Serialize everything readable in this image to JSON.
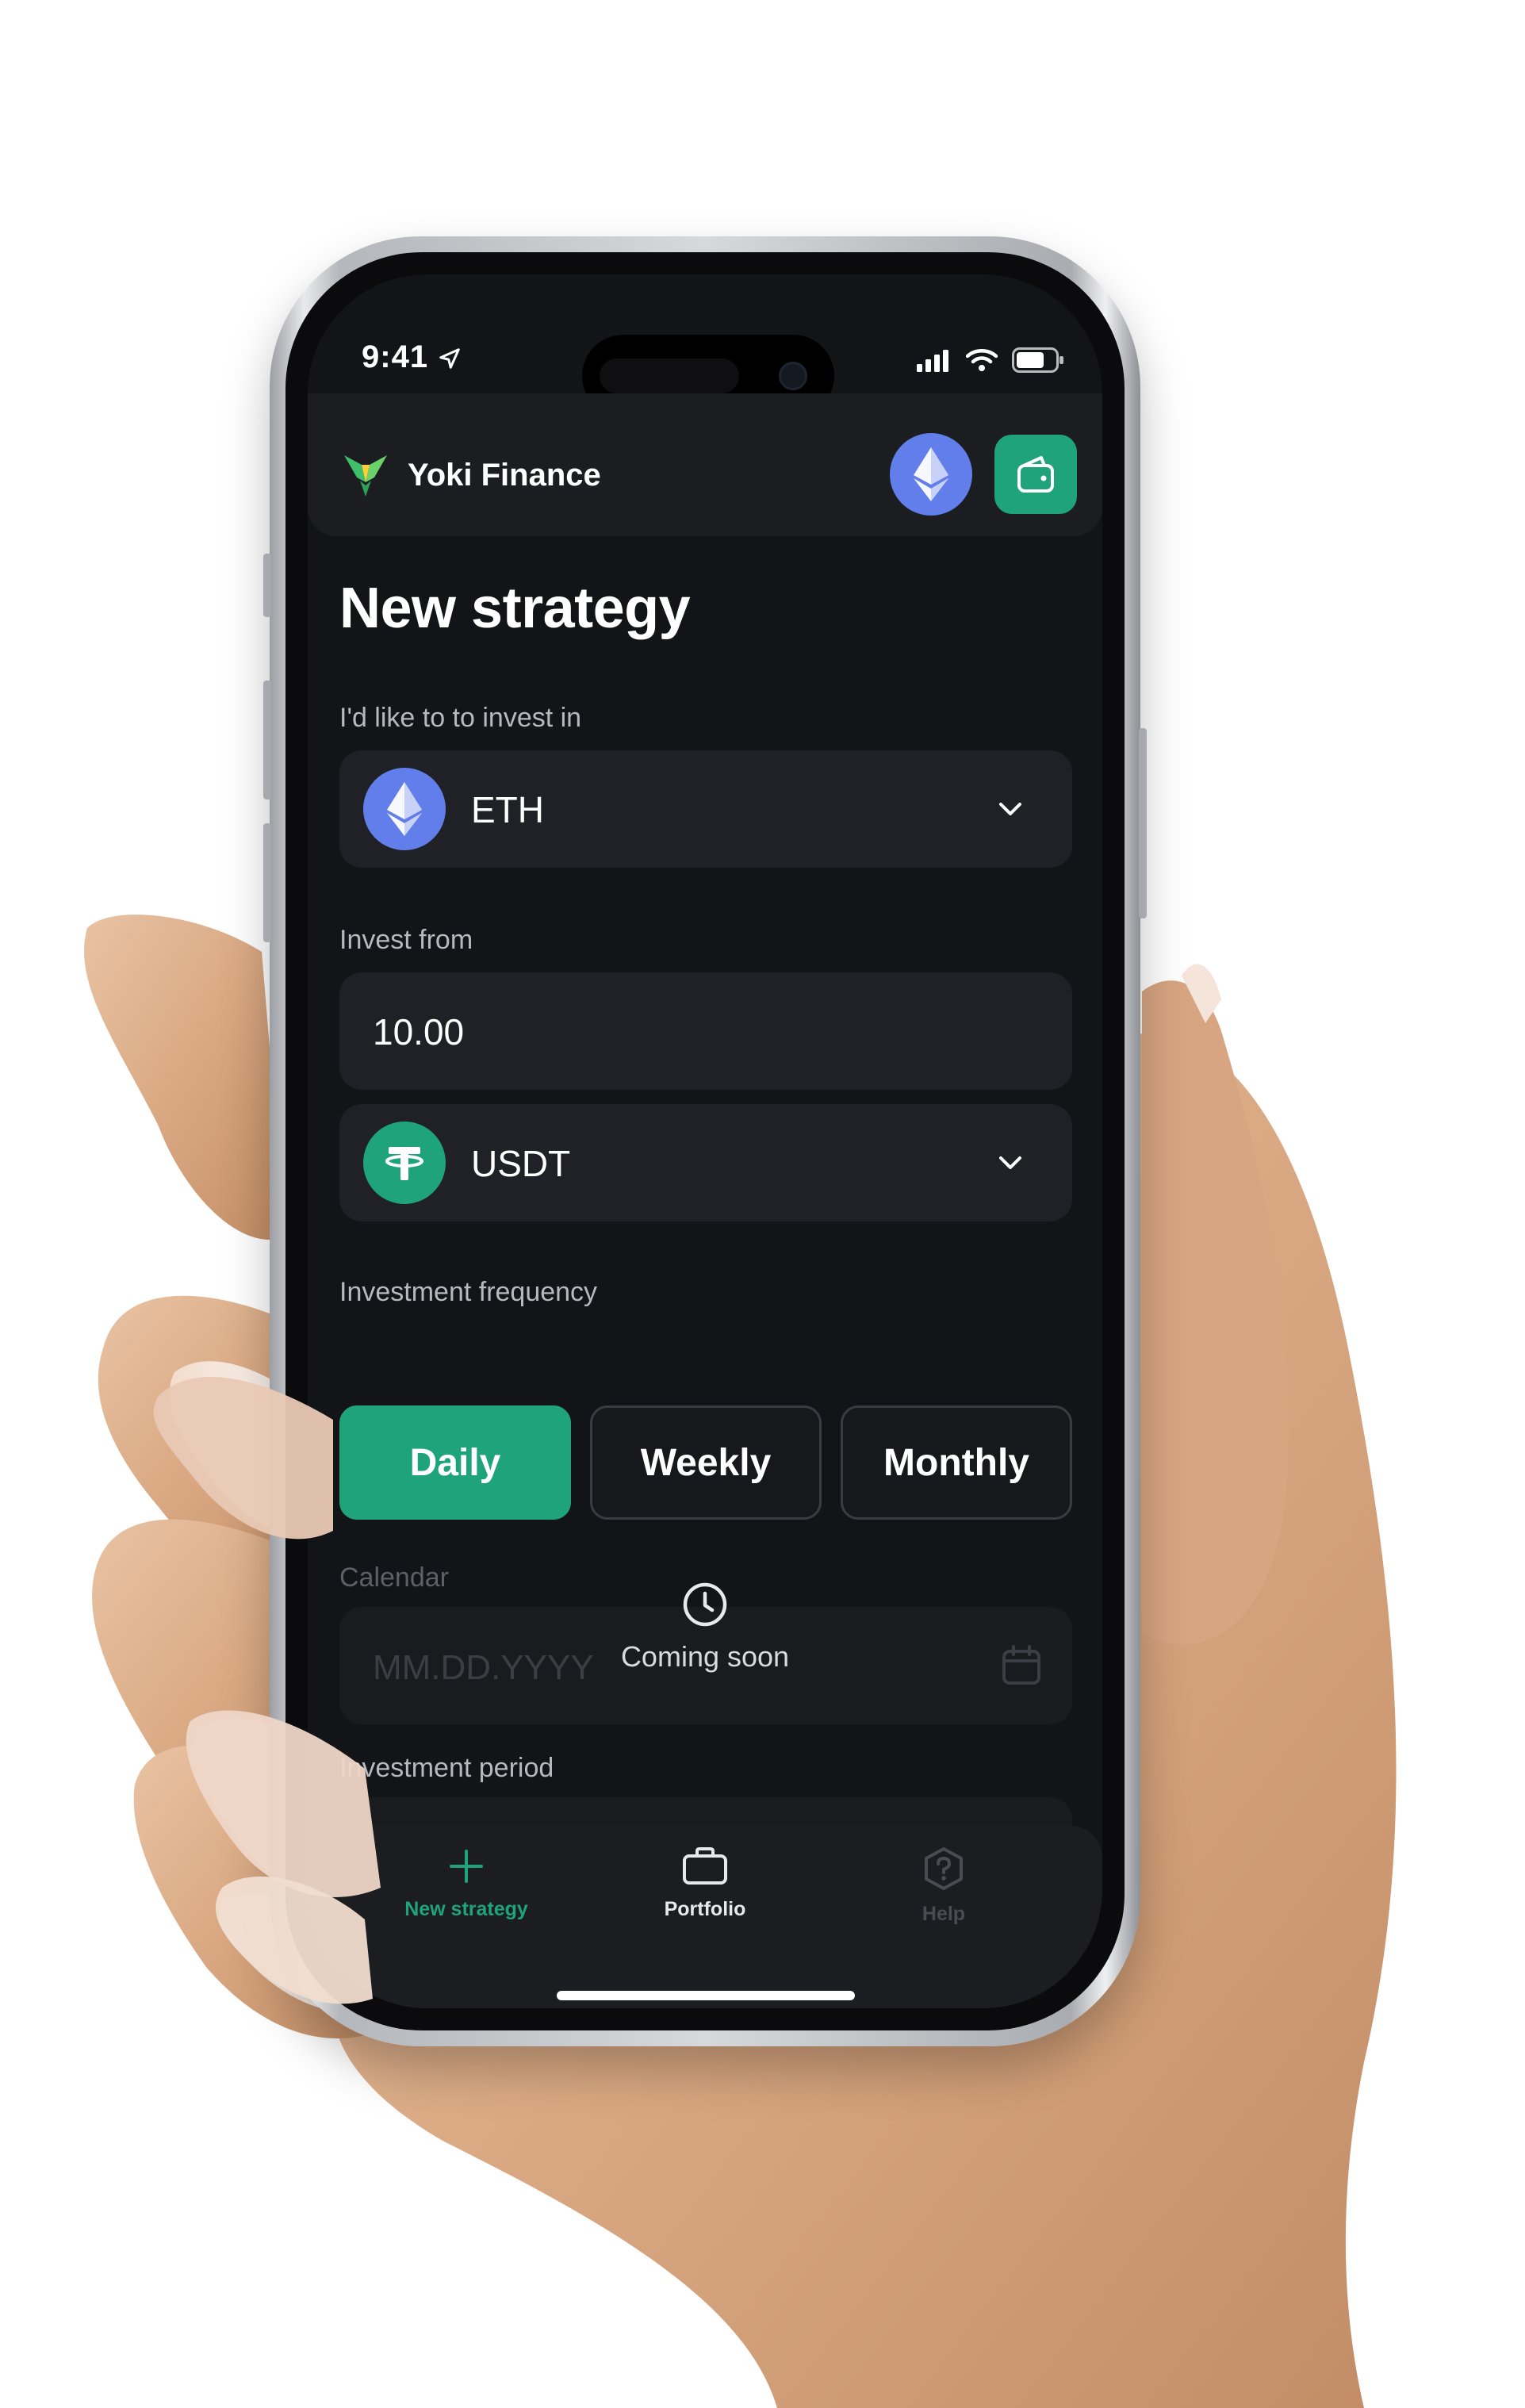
{
  "status_bar": {
    "time": "9:41"
  },
  "header": {
    "brand": "Yoki Finance"
  },
  "page": {
    "title": "New strategy",
    "invest_in": {
      "label": "I'd like to to invest in",
      "coin": "ETH"
    },
    "invest_from": {
      "label": "Invest from",
      "amount": "10.00",
      "coin": "USDT"
    },
    "frequency": {
      "label": "Investment frequency",
      "options": [
        "Daily",
        "Weekly",
        "Monthly"
      ],
      "selected": "Daily"
    },
    "calendar": {
      "label": "Calendar",
      "placeholder": "MM.DD.YYYY",
      "badge": "Coming soon"
    },
    "period": {
      "label": "Investment period"
    }
  },
  "nav": {
    "items": [
      {
        "label": "New strategy",
        "icon": "plus-icon",
        "state": "active"
      },
      {
        "label": "Portfolio",
        "icon": "briefcase-icon",
        "state": "default"
      },
      {
        "label": "Help",
        "icon": "help-hexagon-icon",
        "state": "disabled"
      }
    ]
  },
  "colors": {
    "accent": "#1fa37a",
    "eth": "#627eea",
    "usdt": "#1fa37a",
    "screen_bg": "#131417",
    "field_bg": "#202126"
  }
}
